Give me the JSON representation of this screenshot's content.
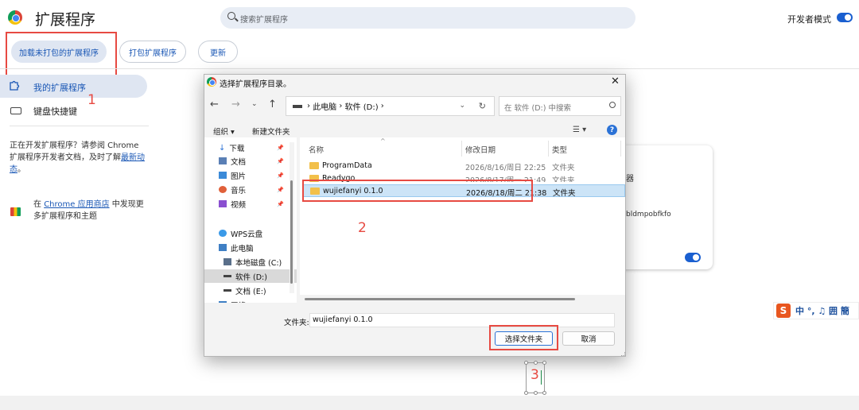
{
  "header": {
    "title": "扩展程序",
    "search_placeholder": "搜索扩展程序",
    "devmode_label": "开发者模式"
  },
  "toolbar": {
    "load_unpacked": "加载未打包的扩展程序",
    "pack": "打包扩展程序",
    "update": "更新"
  },
  "sidebar": {
    "my_extensions": "我的扩展程序",
    "shortcuts": "键盘快捷键",
    "dev_text_1": "正在开发扩展程序？请参阅 Chrome 扩展程序开发者文档，及时了解",
    "dev_link": "最新动态",
    "dev_text_2": "。",
    "store_prefix": "在 ",
    "store_link": "Chrome 应用商店",
    "store_suffix": " 中发现更多扩展程序和主题"
  },
  "card": {
    "partial_char": "器",
    "partial_id": "bldmpobfkfo"
  },
  "ime": {
    "logo": "S",
    "text": "中 °, ♫ 囲 簡"
  },
  "annotations": {
    "step1": "1",
    "step2": "2",
    "step3": "3"
  },
  "dialog": {
    "title": "选择扩展程序目录。",
    "close": "✕",
    "breadcrumb": [
      "此电脑",
      "软件 (D:)"
    ],
    "search_placeholder": "在 软件 (D:) 中搜索",
    "organize": "组织 ▾",
    "new_folder": "新建文件夹",
    "help": "?",
    "tree": [
      {
        "label": "下载",
        "pinned": true
      },
      {
        "label": "文档",
        "pinned": true
      },
      {
        "label": "图片",
        "pinned": true
      },
      {
        "label": "音乐",
        "pinned": true
      },
      {
        "label": "视频",
        "pinned": true
      },
      {
        "label": "WPS云盘",
        "pinned": false
      },
      {
        "label": "此电脑",
        "pinned": false
      },
      {
        "label": "本地磁盘 (C:)",
        "pinned": false
      },
      {
        "label": "软件 (D:)",
        "pinned": false
      },
      {
        "label": "文档 (E:)",
        "pinned": false
      },
      {
        "label": "网络",
        "pinned": false
      }
    ],
    "columns": {
      "name": "名称",
      "date": "修改日期",
      "type": "类型"
    },
    "files": [
      {
        "name": "ProgramData",
        "date": "2026/8/16/周日 22:25",
        "type": "文件夹"
      },
      {
        "name": "Readygo",
        "date": "2026/8/17/周一 21:49",
        "type": "文件夹"
      },
      {
        "name": "wujiefanyi 0.1.0",
        "date": "2026/8/18/周二 21:38",
        "type": "文件夹"
      }
    ],
    "folder_label": "文件夹:",
    "folder_value": "wujiefanyi 0.1.0",
    "select_button": "选择文件夹",
    "cancel_button": "取消"
  }
}
